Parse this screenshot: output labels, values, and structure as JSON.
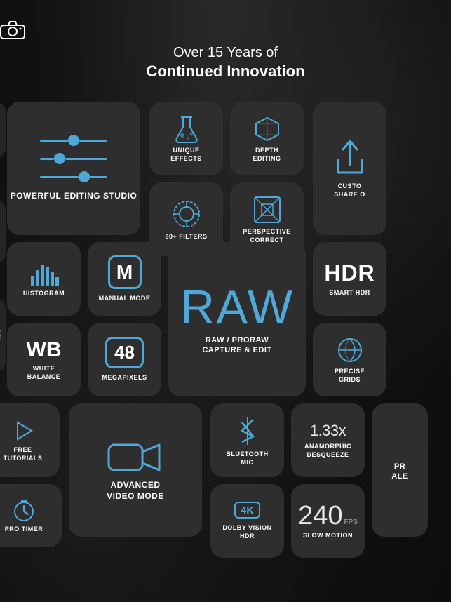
{
  "header": {
    "camera_icon": "📷",
    "subtitle": "Over 15 Years of",
    "title": "Continued Innovation"
  },
  "tiles": {
    "editing": {
      "label": "POWERFUL\nEDITING STUDIO"
    },
    "unique": {
      "label": "UNIQUE\nEFFECTS"
    },
    "depth": {
      "label": "DEPTH\nEDITING"
    },
    "filters": {
      "label": "80+ FILTERS"
    },
    "perspective": {
      "label": "PERSPECTIVE\nCORRECT"
    },
    "share": {
      "label": "CUSTO\nSHARE O"
    },
    "hdr": {
      "number": "HDR",
      "label": "SMART HDR"
    },
    "grids": {
      "label": "PRECISE\nGRIDS"
    },
    "histogram": {
      "label": "HISTOGRAM"
    },
    "manual": {
      "letter": "M",
      "label": "MANUAL MODE"
    },
    "raw": {
      "big": "RAW",
      "label": "RAW / PRORAW\nCAPTURE & EDIT"
    },
    "wb": {
      "letters": "WB",
      "label": "WHITE\nBALANCE"
    },
    "megapixels": {
      "number": "48",
      "label": "MEGAPIXELS"
    },
    "tutorials": {
      "label": "FREE\nTUTORIALS"
    },
    "video": {
      "label": "ADVANCED\nVIDEO MODE"
    },
    "bluetooth": {
      "label": "BLUETOOTH\nMIC"
    },
    "anamorphic": {
      "number": "1.33x",
      "label": "ANAMORPHIC\nDESQUEEZE"
    },
    "dolby": {
      "label": "DOLBY VISION\nHDR",
      "badge": "4K"
    },
    "slowmo": {
      "number": "240",
      "fps": "FPS",
      "label": "SLOW MOTION"
    },
    "protimer": {
      "label": "PRO TIMER"
    },
    "proalert": {
      "label": "PRO\nALE"
    }
  }
}
